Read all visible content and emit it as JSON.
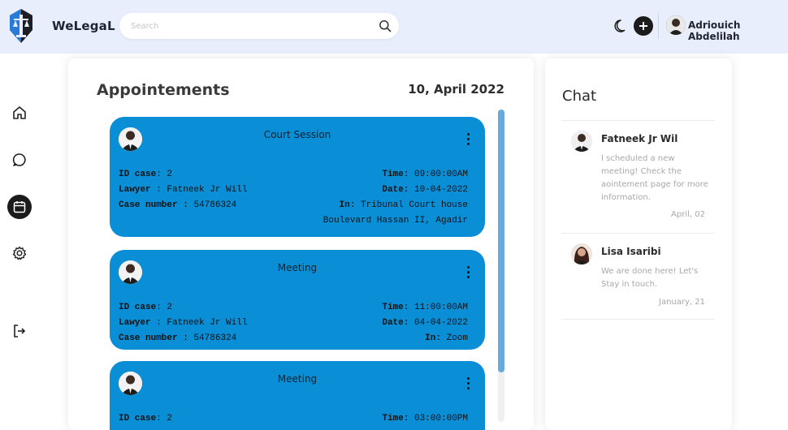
{
  "brand": {
    "name": "WeLegaL"
  },
  "search": {
    "placeholder": "Search"
  },
  "user": {
    "name": "Adriouich Abdelilah"
  },
  "appointments": {
    "title": "Appointements",
    "date": "10, April 2022",
    "cards": [
      {
        "type": "Court Session",
        "left": [
          {
            "k": "ID case",
            "sep": ": ",
            "v": "2"
          },
          {
            "k": "Lawyer",
            "sep": " : ",
            "v": "Fatneek Jr Will"
          },
          {
            "k": "Case number",
            "sep": " : ",
            "v": "54786324"
          }
        ],
        "time_label": "Time:",
        "time": "09:00:00AM",
        "date_label": "Date:",
        "date": "10-04-2022",
        "in_label": "In:",
        "location": "Tribunal Court house",
        "location_line2": "Boulevard Hassan II, Agadir"
      },
      {
        "type": "Meeting",
        "left": [
          {
            "k": "ID case",
            "sep": ": ",
            "v": "2"
          },
          {
            "k": "Lawyer",
            "sep": " : ",
            "v": "Fatneek Jr Will"
          },
          {
            "k": "Case number",
            "sep": " : ",
            "v": "54786324"
          }
        ],
        "time_label": "Time:",
        "time": "11:00:00AM",
        "date_label": "Date:",
        "date": "04-04-2022",
        "in_label": "In:",
        "location": "Zoom"
      },
      {
        "type": "Meeting",
        "left": [
          {
            "k": "ID case",
            "sep": ": ",
            "v": "2"
          }
        ],
        "time_label": "Time:",
        "time": "03:00:00PM"
      }
    ]
  },
  "chat": {
    "title": "Chat",
    "items": [
      {
        "name": "Fatneek Jr Wil",
        "message": "I scheduled a new meeting! Check the aointement page for more information.",
        "time": "April, 02"
      },
      {
        "name": "Lisa Isaribi",
        "message": "We are done here! Let's Stay in touch.",
        "time": "January, 21"
      }
    ]
  },
  "colors": {
    "topbar": "#e8eefb",
    "card": "#0a8fd6",
    "dark": "#1b1b1b",
    "scroll": "#6aa9dd"
  },
  "icons": {
    "sidenav": [
      "home-icon",
      "chat-icon",
      "calendar-icon",
      "settings-icon",
      "logout-icon"
    ]
  }
}
